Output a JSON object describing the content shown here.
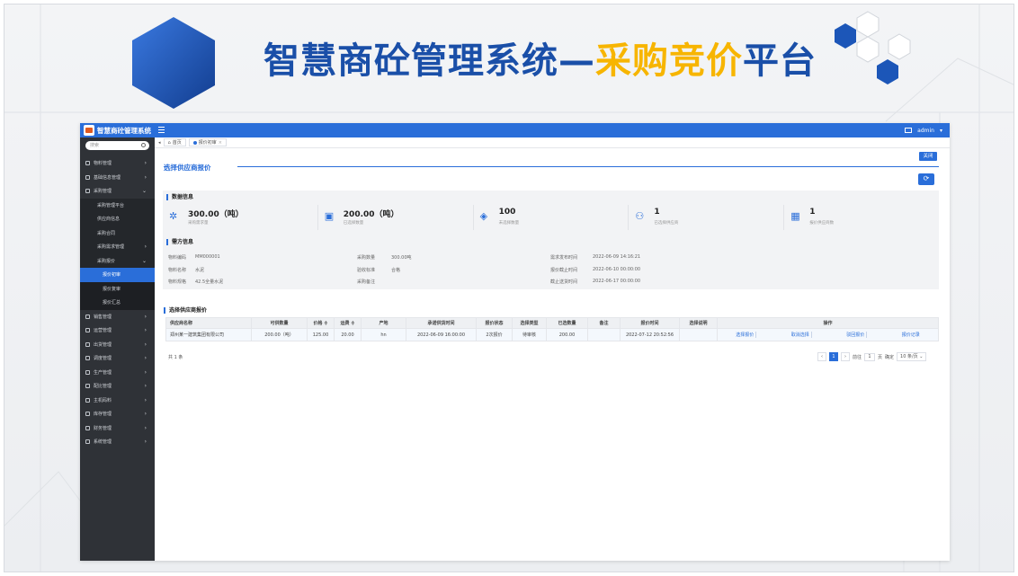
{
  "slide": {
    "title_main": "智慧商砼管理系统—",
    "title_accent": "采购竞价",
    "title_tail": "平台"
  },
  "app": {
    "name": "智慧商砼管理系统",
    "user": "admin"
  },
  "sidebar": {
    "search_placeholder": "搜索",
    "items": [
      {
        "label": "物料管理",
        "level": 0,
        "icon": "chart-icon",
        "arrow": "›"
      },
      {
        "label": "基础信息管理",
        "level": 0,
        "icon": "gear-icon",
        "arrow": "›"
      },
      {
        "label": "采购管理",
        "level": 0,
        "icon": "cart-icon",
        "arrow": "⌄"
      },
      {
        "label": "采购管理平台",
        "level": 1
      },
      {
        "label": "供应商信息",
        "level": 1
      },
      {
        "label": "采购合同",
        "level": 1
      },
      {
        "label": "采购需求管理",
        "level": 1,
        "arrow": "›"
      },
      {
        "label": "采购报价",
        "level": 1,
        "arrow": "⌄"
      },
      {
        "label": "报价初审",
        "level": 2,
        "active": true
      },
      {
        "label": "报价复审",
        "level": 2
      },
      {
        "label": "报价汇总",
        "level": 2
      },
      {
        "label": "销售管理",
        "level": 0,
        "icon": "sales-icon",
        "arrow": "›"
      },
      {
        "label": "运营管理",
        "level": 0,
        "icon": "ops-icon",
        "arrow": "›"
      },
      {
        "label": "出货管理",
        "level": 0,
        "icon": "truck-icon",
        "arrow": "›"
      },
      {
        "label": "调度管理",
        "level": 0,
        "icon": "dispatch-icon",
        "arrow": "›"
      },
      {
        "label": "生产管理",
        "level": 0,
        "icon": "factory-icon",
        "arrow": "›"
      },
      {
        "label": "配比管理",
        "level": 0,
        "icon": "mix-icon",
        "arrow": "›"
      },
      {
        "label": "主机码料",
        "level": 0,
        "icon": "host-icon",
        "arrow": "›"
      },
      {
        "label": "库存管理",
        "level": 0,
        "icon": "stock-icon",
        "arrow": "›"
      },
      {
        "label": "财务管理",
        "level": 0,
        "icon": "finance-icon",
        "arrow": "›"
      },
      {
        "label": "系统管理",
        "level": 0,
        "icon": "system-icon",
        "arrow": "›"
      }
    ]
  },
  "tabs": {
    "home": "首页",
    "current": "报价初审",
    "close": "×"
  },
  "page": {
    "section_title": "选择供应商报价",
    "close_label": "关闭",
    "refresh_icon": "⟳"
  },
  "data_info": {
    "title": "数据信息",
    "stats": [
      {
        "icon": "molecule-icon",
        "glyph": "✲",
        "value": "300.00（吨）",
        "label": "采购需求量"
      },
      {
        "icon": "calendar-icon",
        "glyph": "▣",
        "value": "200.00（吨）",
        "label": "已选择数量"
      },
      {
        "icon": "layers-icon",
        "glyph": "◈",
        "value": "100",
        "label": "未选择数量"
      },
      {
        "icon": "users-icon",
        "glyph": "⚇",
        "value": "1",
        "label": "已选择供应商"
      },
      {
        "icon": "building-icon",
        "glyph": "▦",
        "value": "1",
        "label": "报价供应商数"
      }
    ]
  },
  "demand_info": {
    "title": "需方信息",
    "rows": [
      [
        {
          "k": "物料编码",
          "v": "MM000001"
        },
        {
          "k": "采购数量",
          "v": "300.00吨"
        },
        {
          "k": "需求发布时间",
          "v": "2022-06-09 14:16:21"
        }
      ],
      [
        {
          "k": "物料名称",
          "v": "水泥"
        },
        {
          "k": "验收标准",
          "v": "合格"
        },
        {
          "k": "报价截止时间",
          "v": "2022-06-10 00:00:00"
        }
      ],
      [
        {
          "k": "物料规格",
          "v": "42.5全量水泥"
        },
        {
          "k": "采购备注",
          "v": ""
        },
        {
          "k": "截止送货时间",
          "v": "2022-06-17 00:00:00"
        }
      ]
    ]
  },
  "quotes": {
    "title": "选择供应商报价",
    "columns": [
      "供应商名称",
      "可供数量",
      "价格 ≑",
      "运费 ≑",
      "产地",
      "承诺供货时间",
      "报价状态",
      "选择类型",
      "已选数量",
      "备注",
      "报价时间",
      "选择说明",
      "操作"
    ],
    "rows": [
      {
        "supplier": "郑州某一建筑集团有限公司",
        "qty": "200.00（吨）",
        "price": "125.00",
        "freight": "20.00",
        "origin": "hn",
        "promise_time": "2022-06-09 16:00:00",
        "status": "2次报价",
        "select_type": "待审核",
        "selected_qty": "200.00",
        "remark": "",
        "quote_time": "2022-07-12 20:52:56",
        "select_note": "",
        "ops": [
          "选择报价",
          "取消选择",
          "驳回报价",
          "报价记录"
        ]
      }
    ]
  },
  "pagination": {
    "total": "共 1 条",
    "prev": "‹",
    "page": "1",
    "next": "›",
    "goto_label": "前往",
    "goto_value": "1",
    "page_unit": "页",
    "confirm": "确定",
    "page_size": "10 条/页 ⌄"
  }
}
